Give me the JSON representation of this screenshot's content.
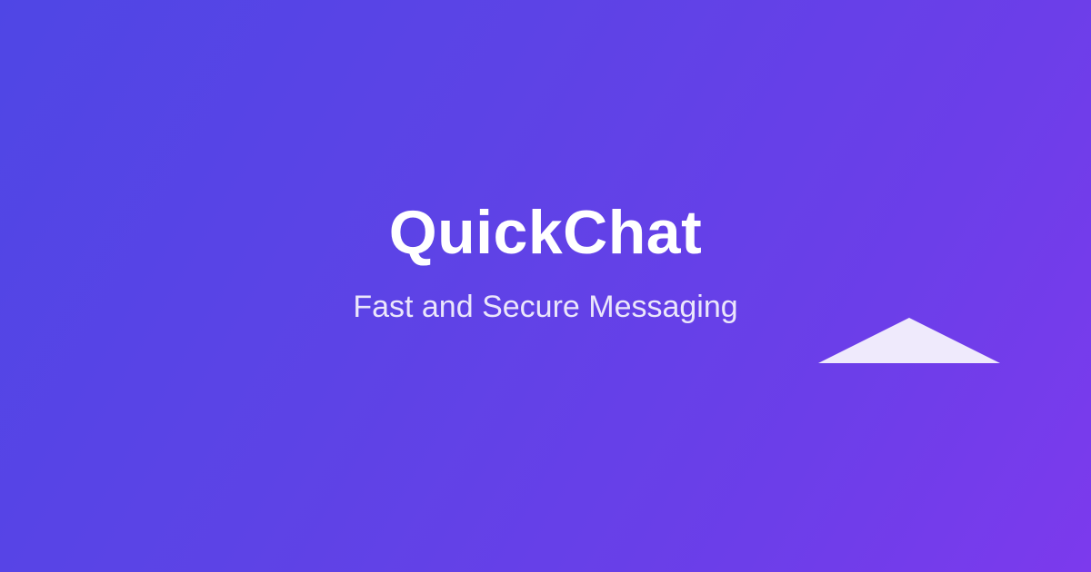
{
  "hero": {
    "title": "QuickChat",
    "subtitle": "Fast and Secure Messaging"
  },
  "colors": {
    "gradient_start": "#4f46e5",
    "gradient_end": "#7c3aed",
    "title_text": "#ffffff",
    "subtitle_text": "#ebe6fb",
    "triangle_fill": "#efeafc"
  },
  "decoration": {
    "shape": "triangle-icon"
  }
}
